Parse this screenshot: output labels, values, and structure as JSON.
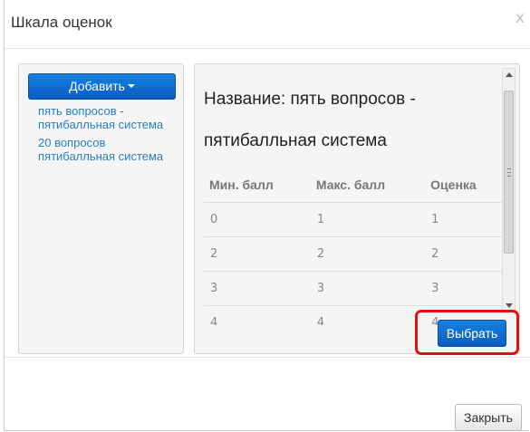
{
  "dialog": {
    "title": "Шкала оценок",
    "close_icon_glyph": "x"
  },
  "sidebar": {
    "add_button_label": "Добавить",
    "items": [
      {
        "label": "пять вопросов - пятибалльная система"
      },
      {
        "label": "20 вопросов пятибалльная система"
      }
    ]
  },
  "detail": {
    "title": "Название: пять вопросов - пятибалльная система",
    "columns": [
      "Мин. балл",
      "Макс. балл",
      "Оценка"
    ],
    "rows": [
      [
        "0",
        "1",
        "1"
      ],
      [
        "2",
        "2",
        "2"
      ],
      [
        "3",
        "3",
        "3"
      ],
      [
        "4",
        "4",
        "4"
      ]
    ],
    "select_button_label": "Выбрать"
  },
  "footer": {
    "close_button_label": "Закрыть"
  },
  "colors": {
    "primary_button": "#0a6fd6",
    "link": "#2a7fb8",
    "highlight": "#e01010"
  }
}
